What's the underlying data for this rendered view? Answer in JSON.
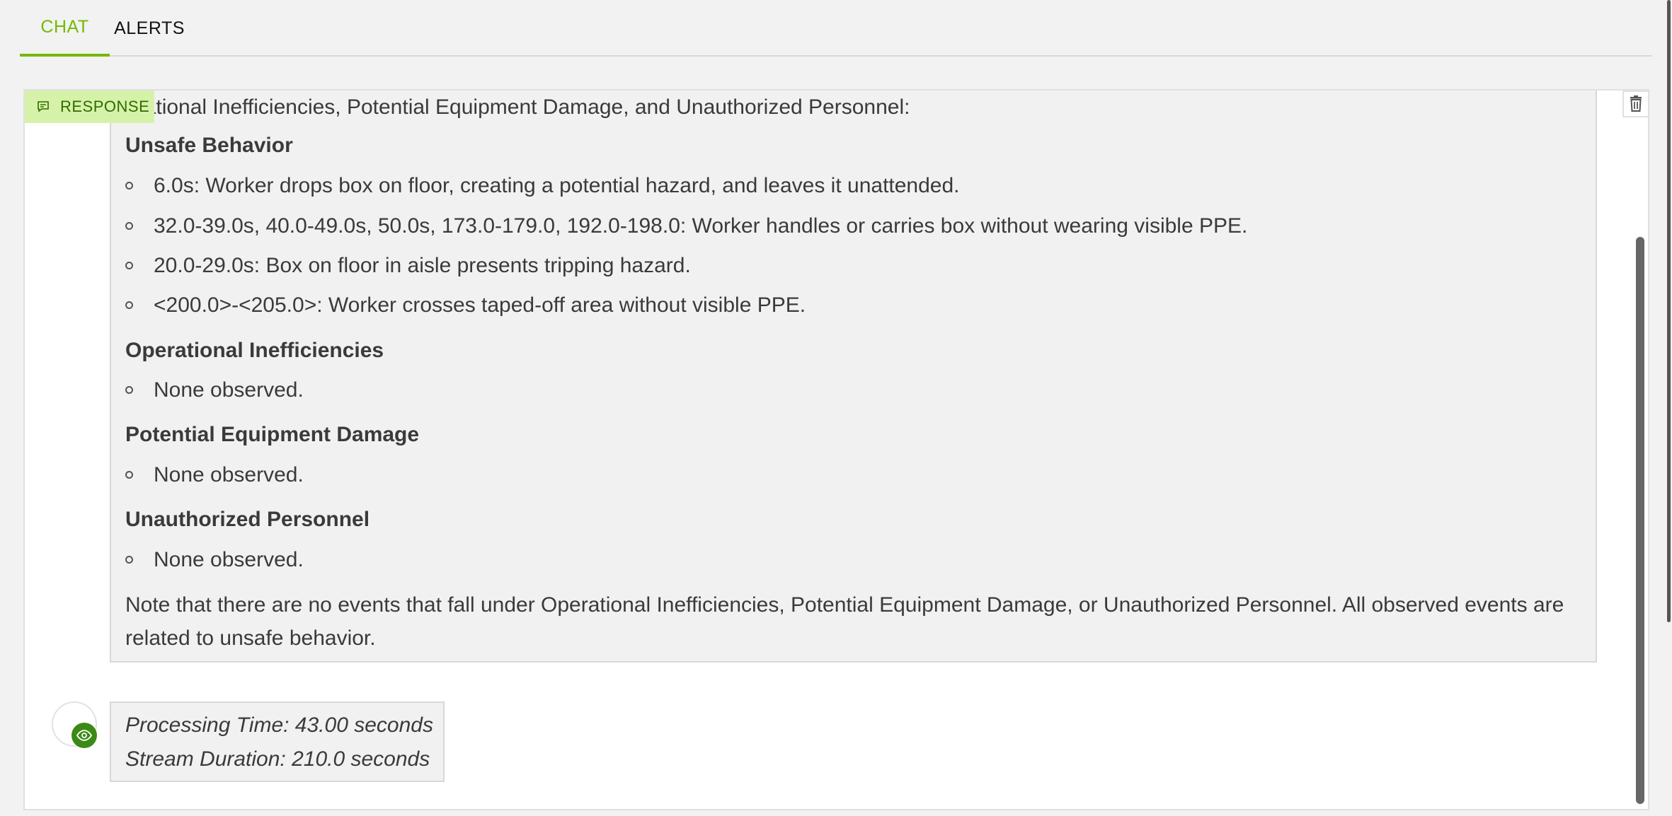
{
  "tabs": [
    {
      "label": "CHAT",
      "active": true
    },
    {
      "label": "ALERTS",
      "active": false
    }
  ],
  "colors": {
    "accent": "#76b900",
    "badge_bg": "#d6f2a9",
    "badge_text": "#2f6b00"
  },
  "response": {
    "badge_label": "RESPONSE",
    "first_line": "erational Inefficiencies, Potential Equipment Damage, and Unauthorized Personnel:",
    "sections": [
      {
        "title": "Unsafe Behavior",
        "items": [
          "6.0s: Worker drops box on floor, creating a potential hazard, and leaves it unattended.",
          "32.0-39.0s, 40.0-49.0s, 50.0s, 173.0-179.0, 192.0-198.0: Worker handles or carries box without wearing visible PPE.",
          "20.0-29.0s: Box on floor in aisle presents tripping hazard.",
          "<200.0>-<205.0>: Worker crosses taped-off area without visible PPE."
        ]
      },
      {
        "title": "Operational Inefficiencies",
        "items": [
          "None observed."
        ]
      },
      {
        "title": "Potential Equipment Damage",
        "items": [
          "None observed."
        ]
      },
      {
        "title": "Unauthorized Personnel",
        "items": [
          "None observed."
        ]
      }
    ],
    "note": "Note that there are no events that fall under Operational Inefficiencies, Potential Equipment Damage, or Unauthorized Personnel. All observed events are related to unsafe behavior."
  },
  "meta": {
    "processing_time": "Processing Time: 43.00 seconds",
    "stream_duration": "Stream Duration: 210.0 seconds"
  },
  "icons": {
    "badge": "message-icon",
    "trash": "trash-icon",
    "avatar": "nvidia-eye-icon"
  }
}
